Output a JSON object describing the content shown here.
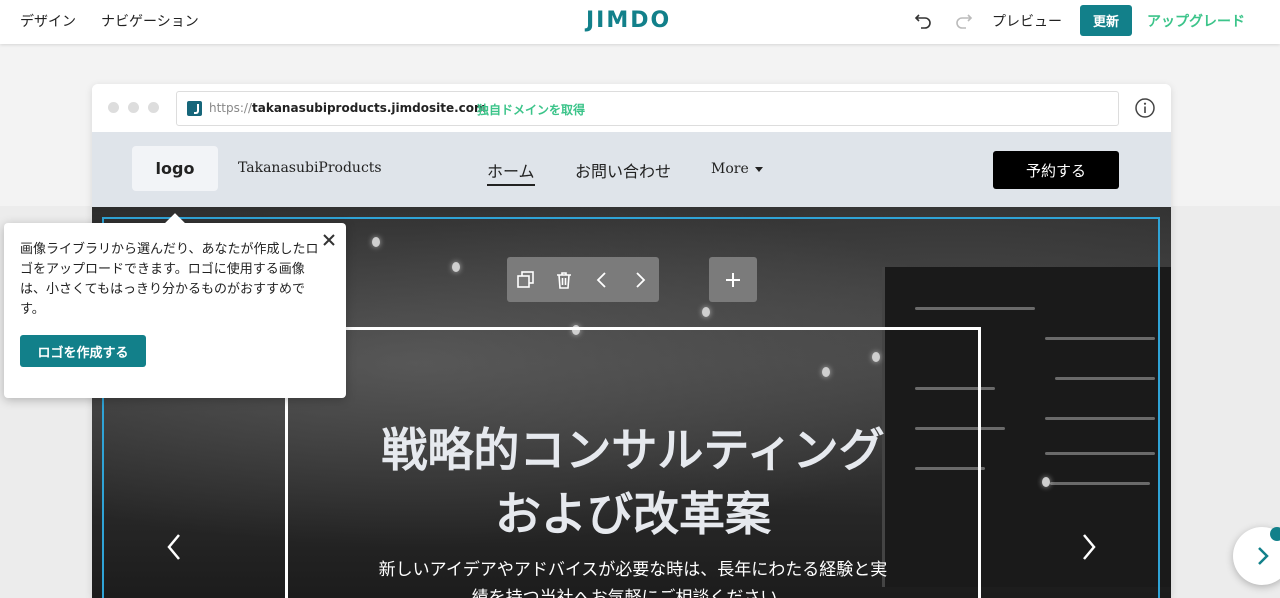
{
  "topbar": {
    "design": "デザイン",
    "navigation": "ナビゲーション",
    "brand": "JIMDO",
    "preview": "プレビュー",
    "update": "更新",
    "upgrade": "アップグレード"
  },
  "browser": {
    "url_protocol": "https://",
    "url_host": "takanasubiproducts.jimdosite.com",
    "custom_domain_link": "独自ドメインを取得"
  },
  "site": {
    "logo_placeholder": "logo",
    "site_name": "TakanasubiProducts",
    "nav": [
      {
        "label": "ホーム",
        "active": true
      },
      {
        "label": "お問い合わせ",
        "active": false
      }
    ],
    "more": "More",
    "book_button": "予約する"
  },
  "hero": {
    "title_line1": "戦略的コンサルティング",
    "title_line2": "および改革案",
    "subtitle_line1": "新しいアイデアやアドバイスが必要な時は、長年にわたる経験と実",
    "subtitle_line2": "績を持つ当社へお気軽にご相談ください。"
  },
  "popover": {
    "text": "画像ライブラリから選んだり、あなたが作成したロゴをアップロードできます。ロゴに使用する画像は、小さくてもはっきり分かるものがおすすめです。",
    "button": "ロゴを作成する"
  },
  "colors": {
    "brand_teal": "#12808a",
    "upgrade_green": "#3cc48a",
    "selection_blue": "#2fa3d6"
  }
}
